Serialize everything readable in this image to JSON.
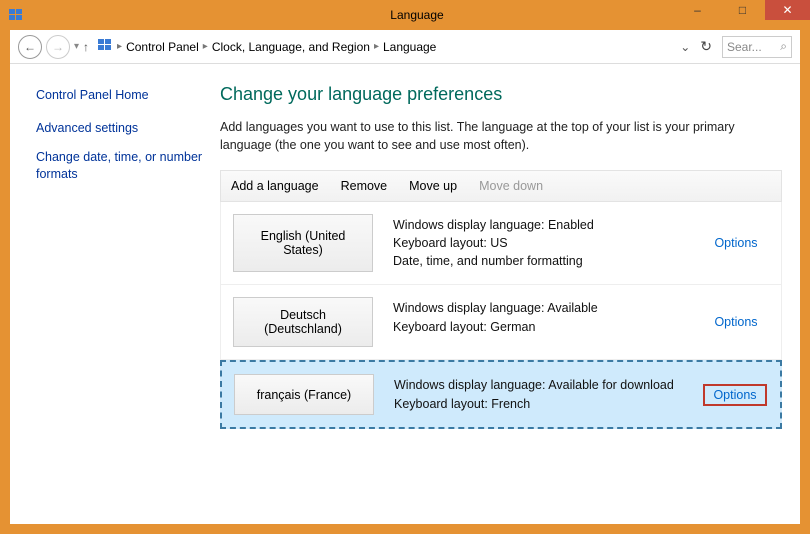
{
  "window": {
    "title": "Language",
    "min_label": "–",
    "max_label": "□",
    "close_label": "✕"
  },
  "nav": {
    "back_glyph": "←",
    "forward_glyph": "→",
    "down_glyph": "▾",
    "up_glyph": "↑",
    "sep": "▸",
    "crumbs": [
      "Control Panel",
      "Clock, Language, and Region",
      "Language"
    ],
    "dropdown_glyph": "⌄",
    "refresh_glyph": "↻",
    "search_placeholder": "Sear...",
    "search_icon": "⌕"
  },
  "sidebar": {
    "home": "Control Panel Home",
    "links": [
      "Advanced settings",
      "Change date, time, or number formats"
    ]
  },
  "main": {
    "heading": "Change your language preferences",
    "description": "Add languages you want to use to this list. The language at the top of your list is your primary language (the one you want to see and use most often).",
    "commands": {
      "add": "Add a language",
      "remove": "Remove",
      "moveup": "Move up",
      "movedown": "Move down"
    },
    "options_label": "Options",
    "languages": [
      {
        "name": "English (United States)",
        "lines": [
          "Windows display language: Enabled",
          "Keyboard layout: US",
          "Date, time, and number formatting"
        ],
        "selected": false,
        "highlight_options": false
      },
      {
        "name": "Deutsch (Deutschland)",
        "lines": [
          "Windows display language: Available",
          "Keyboard layout: German"
        ],
        "selected": false,
        "highlight_options": false
      },
      {
        "name": "français (France)",
        "lines": [
          "Windows display language: Available for download",
          "Keyboard layout: French"
        ],
        "selected": true,
        "highlight_options": true
      }
    ]
  }
}
